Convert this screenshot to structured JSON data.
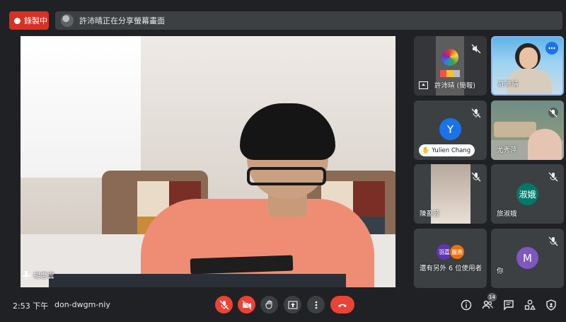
{
  "recording": {
    "label": "錄製中"
  },
  "banner": {
    "text": "許沛晴正在分享螢幕畫面"
  },
  "main_video": {
    "name": "楊惠雲"
  },
  "tiles": [
    {
      "name": "許沛晴 (簡報)"
    },
    {
      "name": "許沛晴"
    },
    {
      "name": "Yulien Chang",
      "initial": "Y"
    },
    {
      "name": "尤秀萍"
    },
    {
      "name": "陳盈芸"
    },
    {
      "name": "旅淑娥",
      "initial": "淑娥"
    },
    {
      "name": "還有另外 6 位使用者",
      "initial_a": "羽嘉",
      "initial_b": "麗燕"
    },
    {
      "name": "你",
      "initial": "M"
    }
  ],
  "bottom": {
    "time": "2:53 下午",
    "meeting_code": "don-dwgm-niy",
    "participant_count": "14"
  },
  "colors": {
    "accent_red": "#ea4335",
    "background": "#202124",
    "tile": "#3c4043",
    "avatar_y": "#1a73e8",
    "avatar_shue": "#00796b",
    "avatar_m": "#7e57c2"
  }
}
